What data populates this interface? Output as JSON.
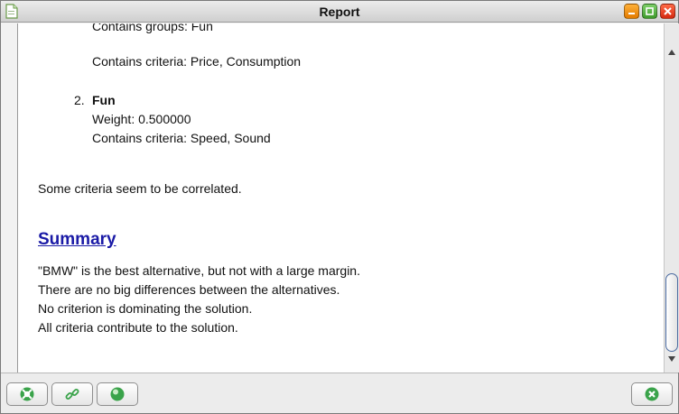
{
  "window": {
    "title": "Report"
  },
  "report": {
    "partial_line": "Contains groups: Fun",
    "group1_criteria": "Contains criteria: Price, Consumption",
    "group2": {
      "number": "2.",
      "name": "Fun",
      "weight": "Weight: 0.500000",
      "criteria": "Contains criteria: Speed, Sound"
    },
    "correlation_note": "Some criteria seem to be correlated.",
    "summary_heading": "Summary",
    "summary_lines": [
      "\"BMW\" is the best alternative, but not with a large margin.",
      "There are no big differences between the alternatives.",
      "No criterion is dominating the solution.",
      "All criteria contribute to the solution."
    ]
  },
  "scrollbar": {
    "position_fraction": 0.85
  },
  "toolbar": {
    "icons": [
      "help-lifebuoy-icon",
      "link-chain-icon",
      "globe-icon",
      "close-circle-icon"
    ]
  },
  "colors": {
    "heading_link": "#1a1aa6",
    "min_button": "#f08a10",
    "max_button": "#4fae3a",
    "close_button": "#e03a1a",
    "accent_green": "#3aa34a"
  }
}
